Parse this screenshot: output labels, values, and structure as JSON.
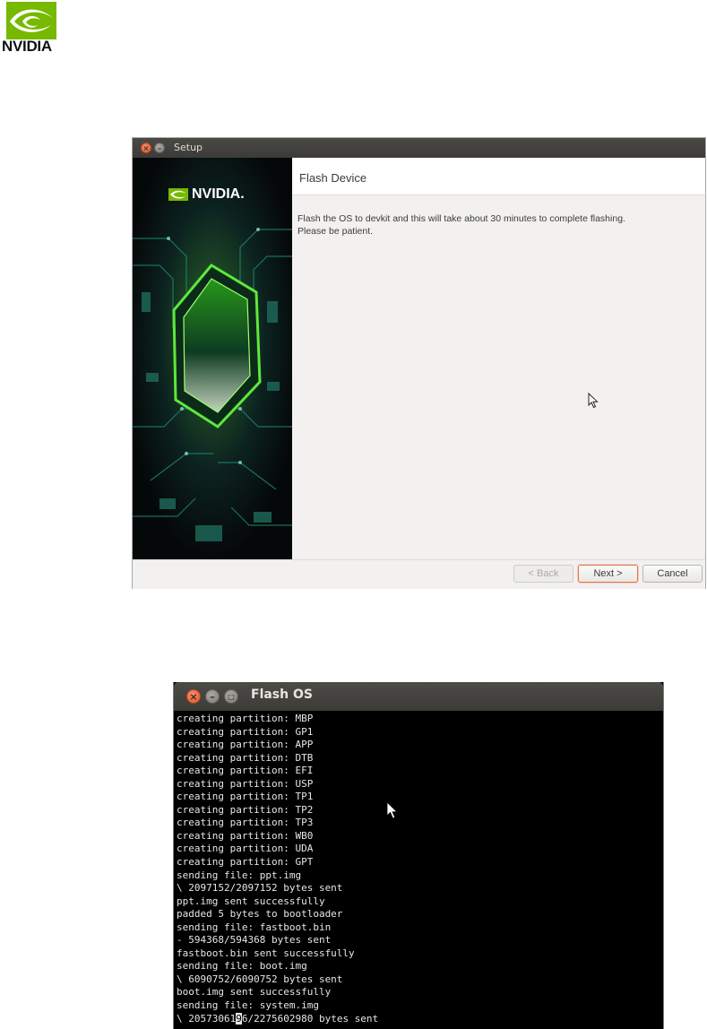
{
  "logo": {
    "wordmark": "NVIDIA"
  },
  "setup_window": {
    "title": "Setup",
    "banner_logo": "NVIDIA.",
    "page_title": "Flash Device",
    "message": "Flash the OS to devkit and this will take about 30 minutes to complete flashing.\nPlease be patient.",
    "buttons": {
      "back": "< Back",
      "next": "Next >",
      "cancel": "Cancel"
    },
    "back_enabled": false
  },
  "terminal_window": {
    "title": "Flash OS",
    "lines": [
      "creating partition: MBP",
      "creating partition: GP1",
      "creating partition: APP",
      "creating partition: DTB",
      "creating partition: EFI",
      "creating partition: USP",
      "creating partition: TP1",
      "creating partition: TP2",
      "creating partition: TP3",
      "creating partition: WB0",
      "creating partition: UDA",
      "creating partition: GPT",
      "sending file: ppt.img",
      "\\ 2097152/2097152 bytes sent",
      "ppt.img sent successfully",
      "padded 5 bytes to bootloader",
      "sending file: fastboot.bin",
      "- 594368/594368 bytes sent",
      "fastboot.bin sent successfully",
      "sending file: boot.img",
      "\\ 6090752/6090752 bytes sent",
      "boot.img sent successfully",
      "sending file: system.img"
    ],
    "last_line": {
      "before": "\\ 20573061",
      "cursor_char": "9",
      "after": "6/2275602980 bytes sent"
    }
  },
  "colors": {
    "nvidia_green": "#76b900",
    "accent_orange": "#e2744b",
    "titlebar": "#3c3b37",
    "terminal_bg": "#000000"
  }
}
